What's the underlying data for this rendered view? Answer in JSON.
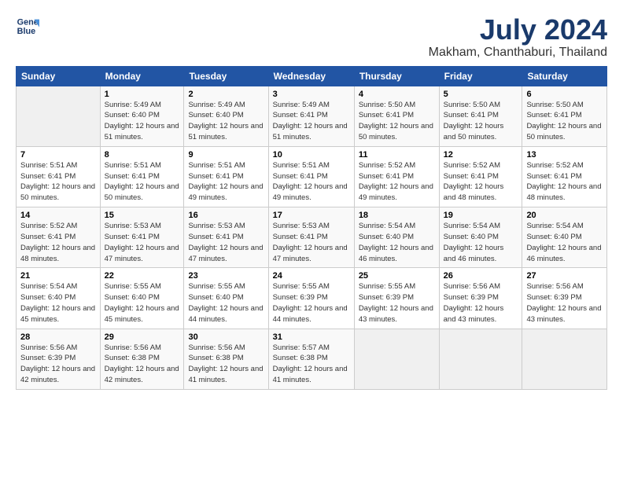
{
  "logo": {
    "line1": "General",
    "line2": "Blue"
  },
  "title": "July 2024",
  "subtitle": "Makham, Chanthaburi, Thailand",
  "headers": [
    "Sunday",
    "Monday",
    "Tuesday",
    "Wednesday",
    "Thursday",
    "Friday",
    "Saturday"
  ],
  "weeks": [
    [
      {
        "day": "",
        "sunrise": "",
        "sunset": "",
        "daylight": ""
      },
      {
        "day": "1",
        "sunrise": "Sunrise: 5:49 AM",
        "sunset": "Sunset: 6:40 PM",
        "daylight": "Daylight: 12 hours and 51 minutes."
      },
      {
        "day": "2",
        "sunrise": "Sunrise: 5:49 AM",
        "sunset": "Sunset: 6:40 PM",
        "daylight": "Daylight: 12 hours and 51 minutes."
      },
      {
        "day": "3",
        "sunrise": "Sunrise: 5:49 AM",
        "sunset": "Sunset: 6:41 PM",
        "daylight": "Daylight: 12 hours and 51 minutes."
      },
      {
        "day": "4",
        "sunrise": "Sunrise: 5:50 AM",
        "sunset": "Sunset: 6:41 PM",
        "daylight": "Daylight: 12 hours and 50 minutes."
      },
      {
        "day": "5",
        "sunrise": "Sunrise: 5:50 AM",
        "sunset": "Sunset: 6:41 PM",
        "daylight": "Daylight: 12 hours and 50 minutes."
      },
      {
        "day": "6",
        "sunrise": "Sunrise: 5:50 AM",
        "sunset": "Sunset: 6:41 PM",
        "daylight": "Daylight: 12 hours and 50 minutes."
      }
    ],
    [
      {
        "day": "7",
        "sunrise": "Sunrise: 5:51 AM",
        "sunset": "Sunset: 6:41 PM",
        "daylight": "Daylight: 12 hours and 50 minutes."
      },
      {
        "day": "8",
        "sunrise": "Sunrise: 5:51 AM",
        "sunset": "Sunset: 6:41 PM",
        "daylight": "Daylight: 12 hours and 50 minutes."
      },
      {
        "day": "9",
        "sunrise": "Sunrise: 5:51 AM",
        "sunset": "Sunset: 6:41 PM",
        "daylight": "Daylight: 12 hours and 49 minutes."
      },
      {
        "day": "10",
        "sunrise": "Sunrise: 5:51 AM",
        "sunset": "Sunset: 6:41 PM",
        "daylight": "Daylight: 12 hours and 49 minutes."
      },
      {
        "day": "11",
        "sunrise": "Sunrise: 5:52 AM",
        "sunset": "Sunset: 6:41 PM",
        "daylight": "Daylight: 12 hours and 49 minutes."
      },
      {
        "day": "12",
        "sunrise": "Sunrise: 5:52 AM",
        "sunset": "Sunset: 6:41 PM",
        "daylight": "Daylight: 12 hours and 48 minutes."
      },
      {
        "day": "13",
        "sunrise": "Sunrise: 5:52 AM",
        "sunset": "Sunset: 6:41 PM",
        "daylight": "Daylight: 12 hours and 48 minutes."
      }
    ],
    [
      {
        "day": "14",
        "sunrise": "Sunrise: 5:52 AM",
        "sunset": "Sunset: 6:41 PM",
        "daylight": "Daylight: 12 hours and 48 minutes."
      },
      {
        "day": "15",
        "sunrise": "Sunrise: 5:53 AM",
        "sunset": "Sunset: 6:41 PM",
        "daylight": "Daylight: 12 hours and 47 minutes."
      },
      {
        "day": "16",
        "sunrise": "Sunrise: 5:53 AM",
        "sunset": "Sunset: 6:41 PM",
        "daylight": "Daylight: 12 hours and 47 minutes."
      },
      {
        "day": "17",
        "sunrise": "Sunrise: 5:53 AM",
        "sunset": "Sunset: 6:41 PM",
        "daylight": "Daylight: 12 hours and 47 minutes."
      },
      {
        "day": "18",
        "sunrise": "Sunrise: 5:54 AM",
        "sunset": "Sunset: 6:40 PM",
        "daylight": "Daylight: 12 hours and 46 minutes."
      },
      {
        "day": "19",
        "sunrise": "Sunrise: 5:54 AM",
        "sunset": "Sunset: 6:40 PM",
        "daylight": "Daylight: 12 hours and 46 minutes."
      },
      {
        "day": "20",
        "sunrise": "Sunrise: 5:54 AM",
        "sunset": "Sunset: 6:40 PM",
        "daylight": "Daylight: 12 hours and 46 minutes."
      }
    ],
    [
      {
        "day": "21",
        "sunrise": "Sunrise: 5:54 AM",
        "sunset": "Sunset: 6:40 PM",
        "daylight": "Daylight: 12 hours and 45 minutes."
      },
      {
        "day": "22",
        "sunrise": "Sunrise: 5:55 AM",
        "sunset": "Sunset: 6:40 PM",
        "daylight": "Daylight: 12 hours and 45 minutes."
      },
      {
        "day": "23",
        "sunrise": "Sunrise: 5:55 AM",
        "sunset": "Sunset: 6:40 PM",
        "daylight": "Daylight: 12 hours and 44 minutes."
      },
      {
        "day": "24",
        "sunrise": "Sunrise: 5:55 AM",
        "sunset": "Sunset: 6:39 PM",
        "daylight": "Daylight: 12 hours and 44 minutes."
      },
      {
        "day": "25",
        "sunrise": "Sunrise: 5:55 AM",
        "sunset": "Sunset: 6:39 PM",
        "daylight": "Daylight: 12 hours and 43 minutes."
      },
      {
        "day": "26",
        "sunrise": "Sunrise: 5:56 AM",
        "sunset": "Sunset: 6:39 PM",
        "daylight": "Daylight: 12 hours and 43 minutes."
      },
      {
        "day": "27",
        "sunrise": "Sunrise: 5:56 AM",
        "sunset": "Sunset: 6:39 PM",
        "daylight": "Daylight: 12 hours and 43 minutes."
      }
    ],
    [
      {
        "day": "28",
        "sunrise": "Sunrise: 5:56 AM",
        "sunset": "Sunset: 6:39 PM",
        "daylight": "Daylight: 12 hours and 42 minutes."
      },
      {
        "day": "29",
        "sunrise": "Sunrise: 5:56 AM",
        "sunset": "Sunset: 6:38 PM",
        "daylight": "Daylight: 12 hours and 42 minutes."
      },
      {
        "day": "30",
        "sunrise": "Sunrise: 5:56 AM",
        "sunset": "Sunset: 6:38 PM",
        "daylight": "Daylight: 12 hours and 41 minutes."
      },
      {
        "day": "31",
        "sunrise": "Sunrise: 5:57 AM",
        "sunset": "Sunset: 6:38 PM",
        "daylight": "Daylight: 12 hours and 41 minutes."
      },
      {
        "day": "",
        "sunrise": "",
        "sunset": "",
        "daylight": ""
      },
      {
        "day": "",
        "sunrise": "",
        "sunset": "",
        "daylight": ""
      },
      {
        "day": "",
        "sunrise": "",
        "sunset": "",
        "daylight": ""
      }
    ]
  ]
}
